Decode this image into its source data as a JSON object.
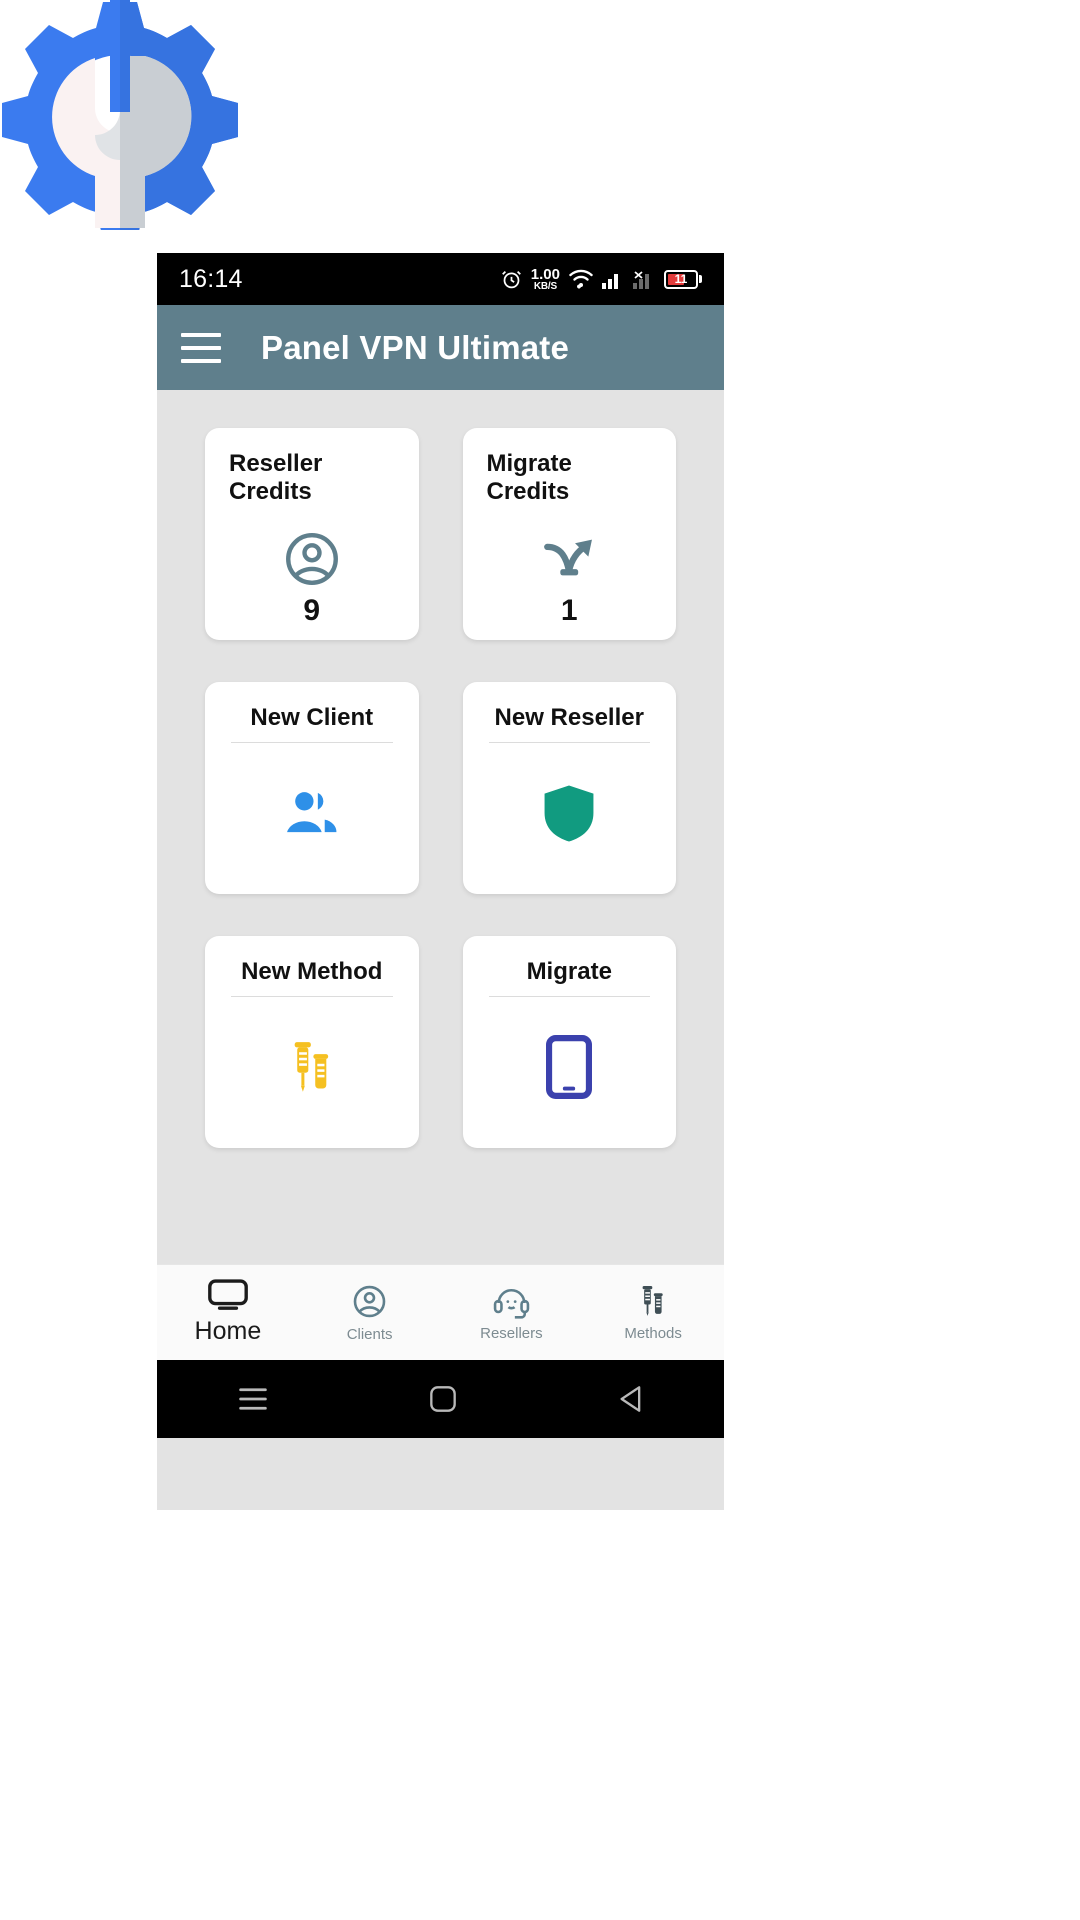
{
  "logo": {
    "name": "gear-wrench-logo",
    "colors": {
      "gear": "#3b7bef",
      "wrench_light": "#f8f1f1",
      "wrench_gray": "#ccd0d4"
    }
  },
  "status_bar": {
    "time": "16:14",
    "alarm_icon": "alarm-icon",
    "net_speed_value": "1.00",
    "net_speed_unit": "KB/S",
    "wifi_icon": "wifi-icon",
    "signal_icon": "signal-bars-icon",
    "sim_off_icon": "signal-off-icon",
    "battery_level": "11",
    "battery_icon": "battery-icon"
  },
  "app_bar": {
    "menu_icon": "hamburger-menu-icon",
    "title": "Panel VPN Ultimate",
    "background": "#5f7f8c"
  },
  "cards": [
    {
      "id": "reseller-credits",
      "title": "Reseller Credits",
      "type": "stat",
      "value": "9",
      "icon": "account-circle-icon",
      "icon_color": "#5f7f8c",
      "title_align": "left"
    },
    {
      "id": "migrate-credits",
      "title": "Migrate Credits",
      "type": "stat",
      "value": "1",
      "icon": "call-split-arrow-icon",
      "icon_color": "#5f7f8c",
      "title_align": "left"
    },
    {
      "id": "new-client",
      "title": "New Client",
      "type": "action",
      "icon": "people-group-icon",
      "icon_color": "#2e90e8",
      "title_align": "center"
    },
    {
      "id": "new-reseller",
      "title": "New Reseller",
      "type": "action",
      "icon": "shield-icon",
      "icon_color": "#119b80",
      "title_align": "center"
    },
    {
      "id": "new-method",
      "title": "New Method",
      "type": "action",
      "icon": "vaccine-syringe-icon",
      "icon_color": "#f5c021",
      "title_align": "center"
    },
    {
      "id": "migrate",
      "title": "Migrate",
      "type": "action",
      "icon": "smartphone-icon",
      "icon_color": "#3b41ad",
      "title_align": "center"
    }
  ],
  "bottom_nav": {
    "items": [
      {
        "id": "home",
        "label": "Home",
        "icon": "tv-screen-icon",
        "active": true
      },
      {
        "id": "clients",
        "label": "Clients",
        "icon": "account-circle-icon",
        "active": false
      },
      {
        "id": "resellers",
        "label": "Resellers",
        "icon": "headset-support-icon",
        "active": false
      },
      {
        "id": "methods",
        "label": "Methods",
        "icon": "vaccine-syringe-icon",
        "active": false
      }
    ]
  },
  "system_nav": {
    "recents_icon": "recents-icon",
    "home_icon": "home-square-icon",
    "back_icon": "back-triangle-icon"
  }
}
